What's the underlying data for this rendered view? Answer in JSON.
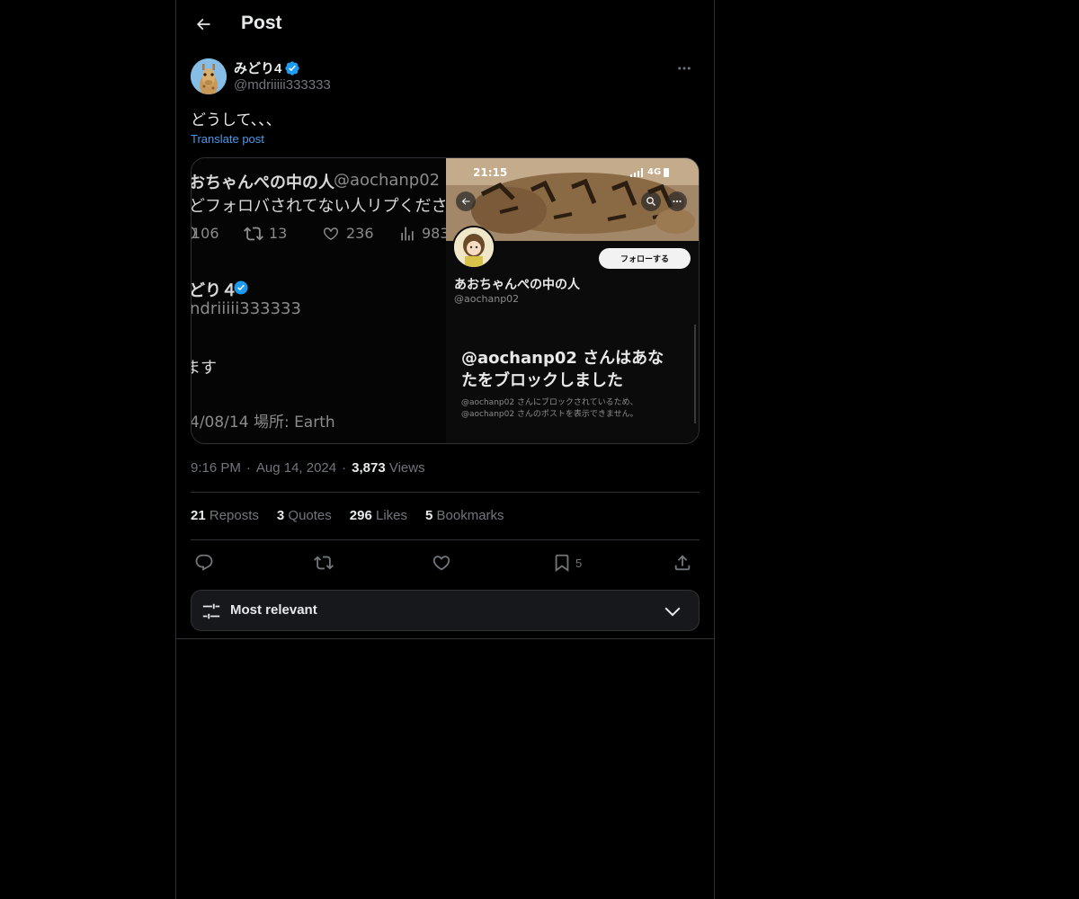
{
  "header": {
    "title": "Post"
  },
  "author": {
    "display_name": "みどり4",
    "handle": "@mdriiiii333333",
    "verified": true
  },
  "post": {
    "text": "どうして、、、",
    "translate_label": "Translate post",
    "time": "9:16 PM",
    "date": "Aug 14, 2024",
    "views_count": "3,873",
    "views_label": "Views"
  },
  "stats": {
    "reposts": {
      "count": "21",
      "label": "Reposts"
    },
    "quotes": {
      "count": "3",
      "label": "Quotes"
    },
    "likes": {
      "count": "296",
      "label": "Likes"
    },
    "bookmarks": {
      "count": "5",
      "label": "Bookmarks"
    }
  },
  "actions": {
    "bookmark_count": "5"
  },
  "sort": {
    "label": "Most relevant"
  },
  "media": {
    "left": {
      "name_line": "おちゃんぺの中の人",
      "handle_line": "@aochanp02 ·",
      "text_line": "どフォロバされてない人リプくださ",
      "replies": "106",
      "reposts": "13",
      "likes": "236",
      "views": "983",
      "user_name": "どり４",
      "user_handle": "ndriiiii333333",
      "body_line": "ます",
      "joined_line": "4/08/14 場所: Earth"
    },
    "right": {
      "status_time": "21:15",
      "status_net": "4G",
      "follow_button": "フォローする",
      "profile_name": "あおちゃんぺの中の人",
      "profile_handle": "@aochanp02",
      "blocked_title_1": "@aochanp02 さんはあな",
      "blocked_title_2": "たをブロックしました",
      "blocked_desc_1": "@aochanp02 さんにブロックされているため、",
      "blocked_desc_2": "@aochanp02 さんのポストを表示できません。"
    }
  },
  "colors": {
    "accent": "#1d9bf0",
    "link": "#4a99e9",
    "muted": "#71767b",
    "text": "#e7e9ea",
    "border": "#2f3336",
    "background": "#000000"
  }
}
